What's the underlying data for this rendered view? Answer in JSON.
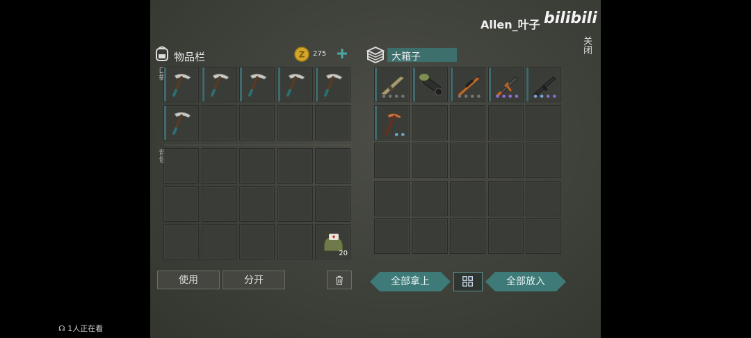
{
  "header": {
    "username": "Allen_叶子",
    "bilibili_logo": "bilibili",
    "close_label": "关闭"
  },
  "inventory": {
    "title": "物品栏",
    "coins": "275",
    "pocket_label": "口袋",
    "backpack_label": "背包"
  },
  "chest": {
    "title": "大箱子"
  },
  "pocket_items": [
    "pickaxe",
    "pickaxe",
    "pickaxe",
    "pickaxe",
    "pickaxe",
    "pickaxe"
  ],
  "backpack_items": [
    {
      "slot": 14,
      "name": "medkit-bag",
      "count": "20"
    }
  ],
  "chest_items": [
    {
      "name": "rifle-beige"
    },
    {
      "name": "rocket-launcher"
    },
    {
      "name": "sniper-rifle"
    },
    {
      "name": "ak-rifle"
    },
    {
      "name": "m4-rifle"
    },
    {
      "name": "pickaxe-copper"
    }
  ],
  "buttons": {
    "use": "使用",
    "split": "分开",
    "take_all": "全部拿上",
    "put_all": "全部放入"
  },
  "footer": {
    "viewers": "1人正在看"
  },
  "colors": {
    "teal_button": "#3d7a78",
    "slot_bar": "#3f6a6e",
    "coin": "#d4a62a"
  }
}
